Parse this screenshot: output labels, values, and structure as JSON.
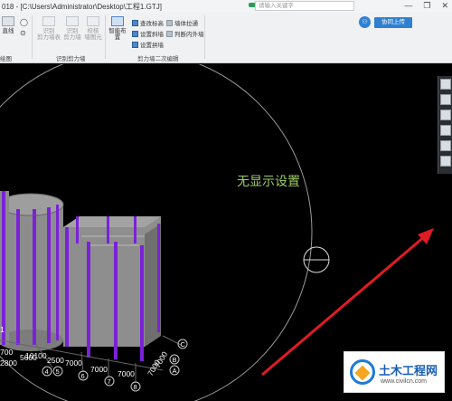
{
  "window": {
    "title": "018 - [C:\\Users\\Administrator\\Desktop\\工程1.GTJ]",
    "search_placeholder": "请输入关键字",
    "share_label": "协同上传",
    "controls": [
      "—",
      "❐",
      "✕"
    ]
  },
  "ribbon": {
    "left_buttons": [
      {
        "label": "直线"
      },
      {
        "label": "识别\n剪力墙表"
      },
      {
        "label": "识别\n剪力墙"
      },
      {
        "label": "校核\n墙图元"
      }
    ],
    "smart_layout": {
      "label": "智能布置"
    },
    "small_buttons": [
      {
        "label": "查改标高"
      },
      {
        "label": "墙体拉通"
      },
      {
        "label": "设置斜墙"
      },
      {
        "label": "判断内外墙"
      },
      {
        "label": "设置拱墙"
      }
    ],
    "groups": [
      {
        "label": "绘图"
      },
      {
        "label": "识别剪力墙"
      },
      {
        "label": "剪力墙二次编辑"
      }
    ]
  },
  "viewport": {
    "status_text": "无显示设置",
    "axis_labels": {
      "dims_left": [
        "700",
        "2800",
        "5600",
        "2500"
      ],
      "dims_mid": [
        "10100"
      ],
      "dims_bottom": [
        "7000",
        "7000",
        "7000"
      ],
      "dims_right": [
        "7000",
        "7000"
      ],
      "grid_numbers": [
        "4",
        "5",
        "6",
        "7",
        "8"
      ],
      "grid_letters": [
        "A",
        "B",
        "C"
      ],
      "left_mark": "1"
    }
  },
  "right_toolbar": {
    "icons": [
      "view-cube-icon",
      "rotate-icon",
      "display-icon",
      "layer-icon",
      "refresh-icon",
      "fit-icon"
    ]
  },
  "watermark": {
    "title": "土木工程网",
    "url": "www.civilcn.com"
  },
  "colors": {
    "wall_fill": "#8f8f8f",
    "wall_dark": "#6f6f6f",
    "stripe": "#7a22d8",
    "arrow": "#e01b24",
    "text_green": "#9ccc65"
  }
}
